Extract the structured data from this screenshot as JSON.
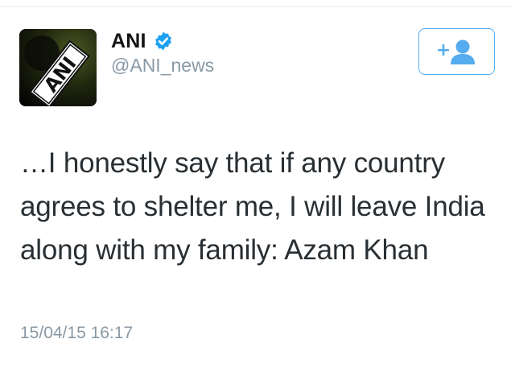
{
  "tweet": {
    "author": {
      "display_name": "ANI",
      "handle": "@ANI_news",
      "verified": true,
      "avatar_logo_text": "ANI"
    },
    "follow_button": {
      "icon": "add-user-icon",
      "symbol": "+"
    },
    "text": "…I honestly say that if any country agrees to shelter me, I will leave India along with my family: Azam Khan",
    "timestamp": "15/04/15 16:17"
  },
  "colors": {
    "accent": "#55acee",
    "text": "#292f33",
    "muted": "#8899a6",
    "name": "#141414"
  }
}
